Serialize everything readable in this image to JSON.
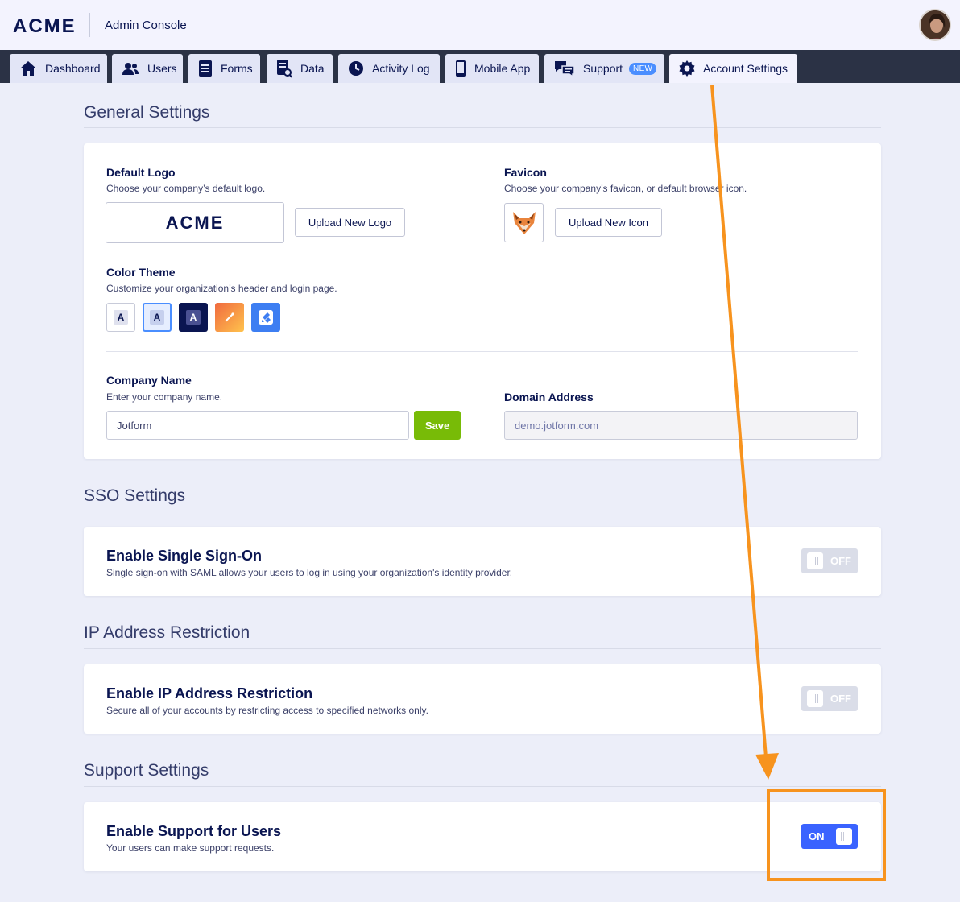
{
  "header": {
    "logo": "ACME",
    "title": "Admin Console"
  },
  "nav": {
    "tabs": [
      {
        "label": "Dashboard",
        "icon": "home-icon"
      },
      {
        "label": "Users",
        "icon": "users-icon"
      },
      {
        "label": "Forms",
        "icon": "forms-icon"
      },
      {
        "label": "Data",
        "icon": "data-icon"
      },
      {
        "label": "Activity Log",
        "icon": "clock-icon"
      },
      {
        "label": "Mobile App",
        "icon": "mobile-icon"
      },
      {
        "label": "Support",
        "icon": "chat-icon",
        "badge": "NEW"
      },
      {
        "label": "Account Settings",
        "icon": "gear-icon",
        "active": true
      }
    ]
  },
  "general": {
    "title": "General Settings",
    "default_logo": {
      "label": "Default Logo",
      "description": "Choose your company’s default logo.",
      "preview": "ACME",
      "button": "Upload New Logo"
    },
    "favicon": {
      "label": "Favicon",
      "description": "Choose your company’s favicon, or default browser icon.",
      "button": "Upload New Icon"
    },
    "color_theme": {
      "label": "Color Theme",
      "description": "Customize your organization’s header and login page.",
      "swatches": [
        "A",
        "A",
        "A"
      ],
      "selected_index": 1
    },
    "company_name": {
      "label": "Company Name",
      "description": "Enter your company name.",
      "value": "Jotform",
      "save_label": "Save"
    },
    "domain": {
      "label": "Domain Address",
      "value": "demo.jotform.com"
    }
  },
  "sso": {
    "title": "SSO Settings",
    "setting_title": "Enable Single Sign-On",
    "description": "Single sign-on with SAML allows your users to log in using your organization's identity provider.",
    "toggle": "OFF"
  },
  "ip": {
    "title": "IP Address Restriction",
    "setting_title": "Enable IP Address Restriction",
    "description": "Secure all of your accounts by restricting access to specified networks only.",
    "toggle": "OFF"
  },
  "support": {
    "title": "Support Settings",
    "setting_title": "Enable Support for Users",
    "description": "Your users can make support requests.",
    "toggle": "ON"
  },
  "colors": {
    "accent": "#3a63ff",
    "save": "#78bb07",
    "annotation": "#f7931e",
    "navbar": "#2b3245"
  }
}
